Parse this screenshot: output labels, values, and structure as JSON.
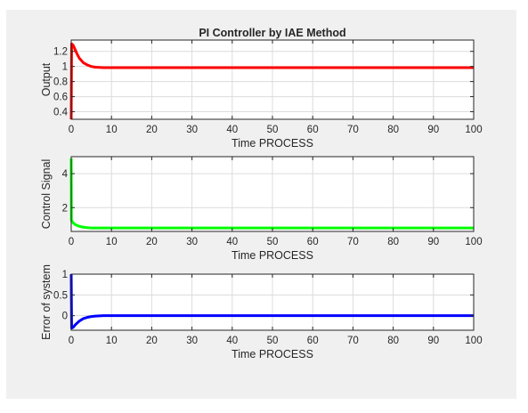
{
  "figure": {
    "background": "#f0f0f0",
    "axes_background": "#ffffff"
  },
  "chart_data": [
    {
      "type": "line",
      "title": "PI Controller by IAE Method",
      "xlabel": "Time PROCESS",
      "ylabel": "Output",
      "xlim": [
        0,
        100
      ],
      "ylim": [
        0.3,
        1.35
      ],
      "xticks": [
        0,
        10,
        20,
        30,
        40,
        50,
        60,
        70,
        80,
        90,
        100
      ],
      "yticks": [
        0.4,
        0.6,
        0.8,
        1,
        1.2
      ],
      "ytick_labels": [
        "0.4",
        "0.6",
        "0.8",
        "1",
        "1.2"
      ],
      "grid": true,
      "color": "#ff0000",
      "x": [
        0,
        0.1,
        0.5,
        1,
        1.5,
        2,
        3,
        4,
        5,
        6,
        8,
        10,
        15,
        20,
        30,
        40,
        50,
        60,
        70,
        80,
        90,
        100
      ],
      "y": [
        0.3,
        1.3,
        1.28,
        1.22,
        1.16,
        1.11,
        1.05,
        1.02,
        1.0,
        0.99,
        0.985,
        0.985,
        0.985,
        0.985,
        0.985,
        0.985,
        0.985,
        0.985,
        0.985,
        0.985,
        0.985,
        0.985
      ]
    },
    {
      "type": "line",
      "title": "",
      "xlabel": "Time PROCESS",
      "ylabel": "Control Signal",
      "xlim": [
        0,
        100
      ],
      "ylim": [
        0.6,
        5.0
      ],
      "xticks": [
        0,
        10,
        20,
        30,
        40,
        50,
        60,
        70,
        80,
        90,
        100
      ],
      "yticks": [
        2,
        4
      ],
      "ytick_labels": [
        "2",
        "4"
      ],
      "grid": true,
      "color": "#00ff00",
      "x": [
        0,
        0.05,
        0.2,
        0.5,
        1,
        2,
        3,
        4,
        5,
        6,
        8,
        10,
        20,
        30,
        40,
        50,
        60,
        70,
        80,
        90,
        100
      ],
      "y": [
        4.9,
        1.25,
        1.2,
        1.1,
        1.0,
        0.9,
        0.85,
        0.82,
        0.8,
        0.8,
        0.8,
        0.8,
        0.8,
        0.8,
        0.8,
        0.8,
        0.8,
        0.8,
        0.8,
        0.8,
        0.8
      ]
    },
    {
      "type": "line",
      "title": "",
      "xlabel": "Time PROCESS",
      "ylabel": "Error of system",
      "xlim": [
        0,
        100
      ],
      "ylim": [
        -0.35,
        1.0
      ],
      "xticks": [
        0,
        10,
        20,
        30,
        40,
        50,
        60,
        70,
        80,
        90,
        100
      ],
      "yticks": [
        0,
        0.5,
        1
      ],
      "ytick_labels": [
        "0",
        "0.5",
        "1"
      ],
      "grid": true,
      "color": "#0000ff",
      "x": [
        0,
        0.1,
        0.5,
        1,
        2,
        3,
        4,
        5,
        6,
        8,
        10,
        15,
        20,
        30,
        40,
        50,
        60,
        70,
        80,
        90,
        100
      ],
      "y": [
        1.0,
        -0.3,
        -0.28,
        -0.22,
        -0.13,
        -0.07,
        -0.04,
        -0.02,
        -0.01,
        0.0,
        0.0,
        0.0,
        0.0,
        0.0,
        0.0,
        0.0,
        0.0,
        0.0,
        0.0,
        0.0,
        0.0
      ]
    }
  ]
}
